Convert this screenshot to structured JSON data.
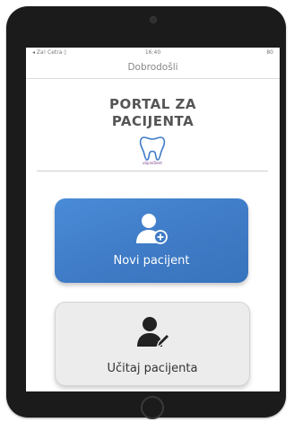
{
  "status_bar": {
    "carrier": "◂ Za! Cetra ◊",
    "time": "16:40",
    "battery": "80"
  },
  "nav": {
    "title": "Dobrodošli"
  },
  "header": {
    "title_line1": "PORTAL ZA",
    "title_line2": "PACIJENTA",
    "logo_text": "uSpiniDent"
  },
  "actions": {
    "new_patient": "Novi pacijent",
    "load_patient": "Učitaj pacijenta"
  },
  "colors": {
    "primary_button": "#3f7bc6",
    "secondary_button": "#ececec",
    "tablet_frame": "#1b1b1b"
  },
  "icons": {
    "new_patient": "add-user-icon",
    "load_patient": "user-edit-icon",
    "logo": "tooth-logo-icon"
  }
}
